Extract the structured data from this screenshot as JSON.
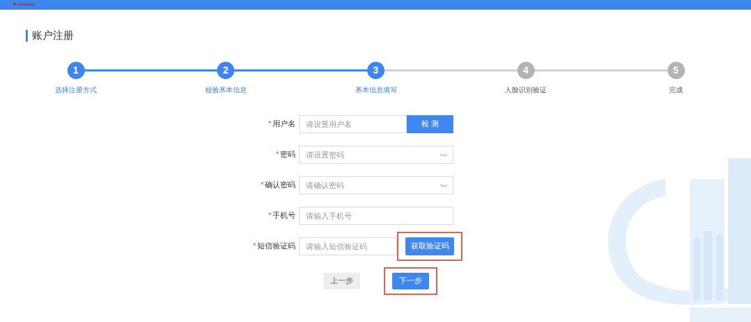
{
  "page_title": "账户注册",
  "steps": [
    {
      "number": "1",
      "label": "选择注册方式",
      "reached": true
    },
    {
      "number": "2",
      "label": "校验基本信息",
      "reached": true
    },
    {
      "number": "3",
      "label": "基本信息填写",
      "reached": true
    },
    {
      "number": "4",
      "label": "人脸识别验证",
      "reached": false
    },
    {
      "number": "5",
      "label": "完成",
      "reached": false
    }
  ],
  "form": {
    "fields": [
      {
        "kind": "button",
        "label": "用户名",
        "required": "*",
        "placeholder": "请设置用户名",
        "button": "检 测",
        "highlighted": false
      },
      {
        "kind": "password",
        "label": "密码",
        "required": "*",
        "placeholder": "请设置密码"
      },
      {
        "kind": "password",
        "label": "确认密码",
        "required": "*",
        "placeholder": "请确认密码"
      },
      {
        "kind": "text",
        "label": "手机号",
        "required": "*",
        "placeholder": "请输入手机号"
      },
      {
        "kind": "button",
        "label": "短信验证码",
        "required": "*",
        "placeholder": "请输入短信验证码",
        "button": "获取验证码",
        "highlighted": true
      }
    ]
  },
  "buttons": [
    {
      "label": "上一步",
      "primary": false,
      "highlighted": false
    },
    {
      "label": "下一步",
      "primary": true,
      "highlighted": true
    }
  ]
}
